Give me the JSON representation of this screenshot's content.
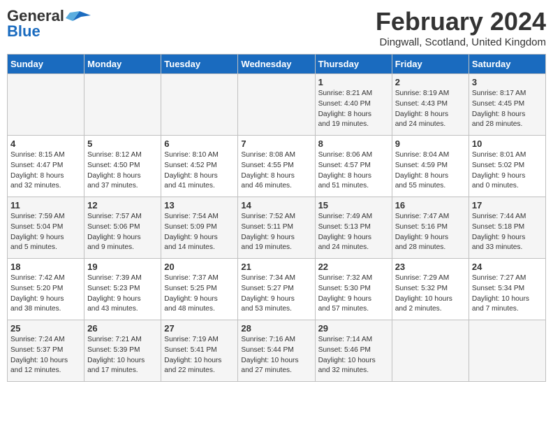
{
  "header": {
    "logo_line1": "General",
    "logo_line2": "Blue",
    "month": "February 2024",
    "location": "Dingwall, Scotland, United Kingdom"
  },
  "days_of_week": [
    "Sunday",
    "Monday",
    "Tuesday",
    "Wednesday",
    "Thursday",
    "Friday",
    "Saturday"
  ],
  "weeks": [
    [
      {
        "day": "",
        "info": ""
      },
      {
        "day": "",
        "info": ""
      },
      {
        "day": "",
        "info": ""
      },
      {
        "day": "",
        "info": ""
      },
      {
        "day": "1",
        "info": "Sunrise: 8:21 AM\nSunset: 4:40 PM\nDaylight: 8 hours\nand 19 minutes."
      },
      {
        "day": "2",
        "info": "Sunrise: 8:19 AM\nSunset: 4:43 PM\nDaylight: 8 hours\nand 24 minutes."
      },
      {
        "day": "3",
        "info": "Sunrise: 8:17 AM\nSunset: 4:45 PM\nDaylight: 8 hours\nand 28 minutes."
      }
    ],
    [
      {
        "day": "4",
        "info": "Sunrise: 8:15 AM\nSunset: 4:47 PM\nDaylight: 8 hours\nand 32 minutes."
      },
      {
        "day": "5",
        "info": "Sunrise: 8:12 AM\nSunset: 4:50 PM\nDaylight: 8 hours\nand 37 minutes."
      },
      {
        "day": "6",
        "info": "Sunrise: 8:10 AM\nSunset: 4:52 PM\nDaylight: 8 hours\nand 41 minutes."
      },
      {
        "day": "7",
        "info": "Sunrise: 8:08 AM\nSunset: 4:55 PM\nDaylight: 8 hours\nand 46 minutes."
      },
      {
        "day": "8",
        "info": "Sunrise: 8:06 AM\nSunset: 4:57 PM\nDaylight: 8 hours\nand 51 minutes."
      },
      {
        "day": "9",
        "info": "Sunrise: 8:04 AM\nSunset: 4:59 PM\nDaylight: 8 hours\nand 55 minutes."
      },
      {
        "day": "10",
        "info": "Sunrise: 8:01 AM\nSunset: 5:02 PM\nDaylight: 9 hours\nand 0 minutes."
      }
    ],
    [
      {
        "day": "11",
        "info": "Sunrise: 7:59 AM\nSunset: 5:04 PM\nDaylight: 9 hours\nand 5 minutes."
      },
      {
        "day": "12",
        "info": "Sunrise: 7:57 AM\nSunset: 5:06 PM\nDaylight: 9 hours\nand 9 minutes."
      },
      {
        "day": "13",
        "info": "Sunrise: 7:54 AM\nSunset: 5:09 PM\nDaylight: 9 hours\nand 14 minutes."
      },
      {
        "day": "14",
        "info": "Sunrise: 7:52 AM\nSunset: 5:11 PM\nDaylight: 9 hours\nand 19 minutes."
      },
      {
        "day": "15",
        "info": "Sunrise: 7:49 AM\nSunset: 5:13 PM\nDaylight: 9 hours\nand 24 minutes."
      },
      {
        "day": "16",
        "info": "Sunrise: 7:47 AM\nSunset: 5:16 PM\nDaylight: 9 hours\nand 28 minutes."
      },
      {
        "day": "17",
        "info": "Sunrise: 7:44 AM\nSunset: 5:18 PM\nDaylight: 9 hours\nand 33 minutes."
      }
    ],
    [
      {
        "day": "18",
        "info": "Sunrise: 7:42 AM\nSunset: 5:20 PM\nDaylight: 9 hours\nand 38 minutes."
      },
      {
        "day": "19",
        "info": "Sunrise: 7:39 AM\nSunset: 5:23 PM\nDaylight: 9 hours\nand 43 minutes."
      },
      {
        "day": "20",
        "info": "Sunrise: 7:37 AM\nSunset: 5:25 PM\nDaylight: 9 hours\nand 48 minutes."
      },
      {
        "day": "21",
        "info": "Sunrise: 7:34 AM\nSunset: 5:27 PM\nDaylight: 9 hours\nand 53 minutes."
      },
      {
        "day": "22",
        "info": "Sunrise: 7:32 AM\nSunset: 5:30 PM\nDaylight: 9 hours\nand 57 minutes."
      },
      {
        "day": "23",
        "info": "Sunrise: 7:29 AM\nSunset: 5:32 PM\nDaylight: 10 hours\nand 2 minutes."
      },
      {
        "day": "24",
        "info": "Sunrise: 7:27 AM\nSunset: 5:34 PM\nDaylight: 10 hours\nand 7 minutes."
      }
    ],
    [
      {
        "day": "25",
        "info": "Sunrise: 7:24 AM\nSunset: 5:37 PM\nDaylight: 10 hours\nand 12 minutes."
      },
      {
        "day": "26",
        "info": "Sunrise: 7:21 AM\nSunset: 5:39 PM\nDaylight: 10 hours\nand 17 minutes."
      },
      {
        "day": "27",
        "info": "Sunrise: 7:19 AM\nSunset: 5:41 PM\nDaylight: 10 hours\nand 22 minutes."
      },
      {
        "day": "28",
        "info": "Sunrise: 7:16 AM\nSunset: 5:44 PM\nDaylight: 10 hours\nand 27 minutes."
      },
      {
        "day": "29",
        "info": "Sunrise: 7:14 AM\nSunset: 5:46 PM\nDaylight: 10 hours\nand 32 minutes."
      },
      {
        "day": "",
        "info": ""
      },
      {
        "day": "",
        "info": ""
      }
    ]
  ]
}
